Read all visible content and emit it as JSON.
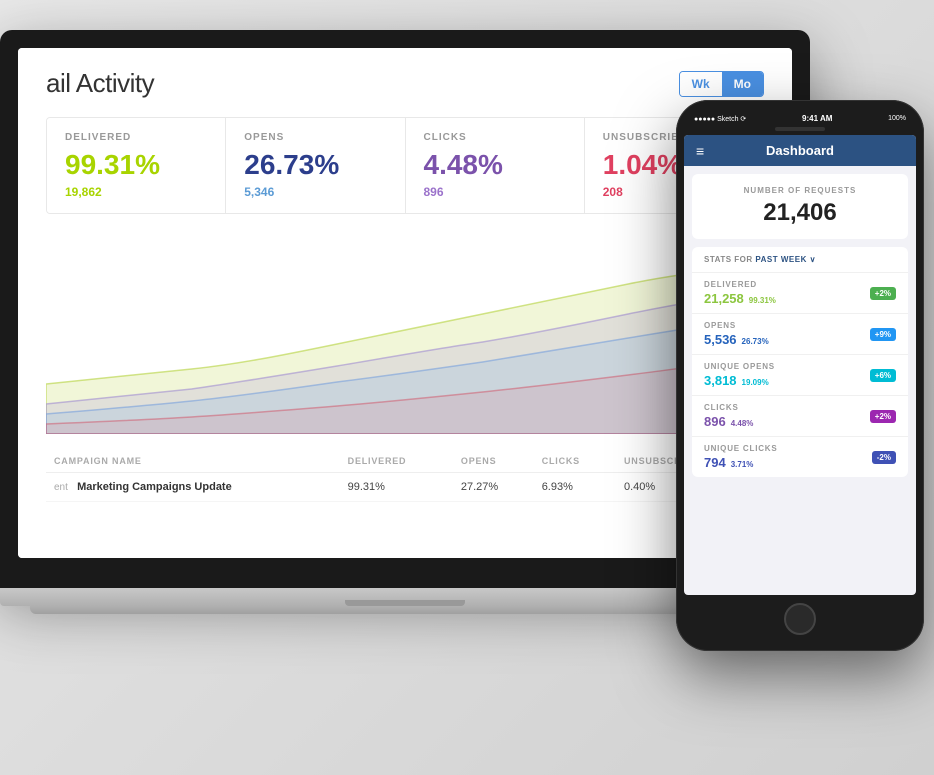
{
  "laptop": {
    "title": "ail Activity",
    "toggle": {
      "wk_label": "Wk",
      "mo_label": "Mo"
    },
    "stats": [
      {
        "label": "DELIVERED",
        "value": "99.31%",
        "sub": "19,862",
        "color": "green"
      },
      {
        "label": "OPENS",
        "value": "26.73%",
        "sub": "5,346",
        "color": "blue"
      },
      {
        "label": "CLICKS",
        "value": "4.48%",
        "sub": "896",
        "color": "purple"
      },
      {
        "label": "UNSUBSCRIBES",
        "value": "1.04%",
        "sub": "208",
        "color": "red"
      }
    ],
    "table": {
      "columns": [
        "CAMPAIGN NAME",
        "DELIVERED",
        "OPENS",
        "CLICKS",
        "UNSUBSCRIBES"
      ],
      "rows": [
        {
          "prefix": "ent",
          "name": "Marketing Campaigns Update",
          "delivered": "99.31%",
          "opens": "27.27%",
          "clicks": "6.93%",
          "unsubscribes": "0.40%"
        }
      ]
    }
  },
  "phone": {
    "status_bar": {
      "signal": "●●●●● Sketch ⟳",
      "time": "9:41 AM",
      "battery": "100%"
    },
    "navbar": {
      "menu_icon": "≡",
      "title": "Dashboard"
    },
    "request_card": {
      "label": "NUMBER OF REQUESTS",
      "value": "21,406"
    },
    "stats_header": "STATS FOR PAST WEEK ∨",
    "stats": [
      {
        "name": "DELIVERED",
        "value": "21,258",
        "pct": "99.31%",
        "badge": "+2%",
        "badge_color": "green",
        "value_color": "#8cc63f"
      },
      {
        "name": "OPENS",
        "value": "5,536",
        "pct": "26.73%",
        "badge": "+9%",
        "badge_color": "blue",
        "value_color": "#2563bc"
      },
      {
        "name": "UNIQUE OPENS",
        "value": "3,818",
        "pct": "19.09%",
        "badge": "+6%",
        "badge_color": "teal",
        "value_color": "#00bcd4"
      },
      {
        "name": "CLICKS",
        "value": "896",
        "pct": "4.48%",
        "badge": "+2%",
        "badge_color": "purple",
        "value_color": "#7b52ab"
      },
      {
        "name": "UNIQUE CLICKS",
        "value": "794",
        "pct": "3.71%",
        "badge": "-2%",
        "badge_color": "darkblue",
        "value_color": "#3f51b5"
      }
    ]
  }
}
